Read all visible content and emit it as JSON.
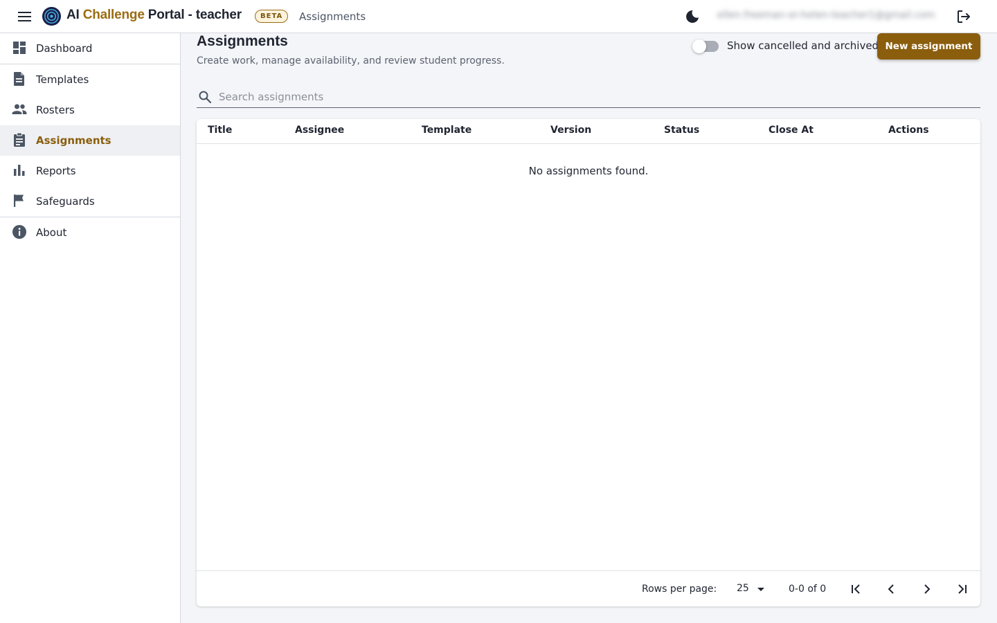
{
  "app": {
    "brand_prefix": "AI ",
    "brand_accent": "Challenge",
    "brand_suffix": " Portal - teacher",
    "beta_badge": "BETA",
    "breadcrumb": "Assignments",
    "user_email": "ellen.freeman-or-helen-teacher1@gmail.com",
    "accent_color": "#8a5e0d"
  },
  "sidebar": {
    "items": [
      {
        "label": "Dashboard",
        "icon": "dashboard-icon"
      },
      {
        "label": "Templates",
        "icon": "document-icon"
      },
      {
        "label": "Rosters",
        "icon": "people-icon"
      },
      {
        "label": "Assignments",
        "icon": "clipboard-icon",
        "active": true
      },
      {
        "label": "Reports",
        "icon": "bar-chart-icon"
      },
      {
        "label": "Safeguards",
        "icon": "flag-icon"
      },
      {
        "label": "About",
        "icon": "info-icon"
      }
    ]
  },
  "main": {
    "title": "Assignments",
    "subtitle": "Create work, manage availability, and review student progress.",
    "show_cancelled_label": "Show cancelled and archived",
    "show_cancelled_on": false,
    "new_button": "New assignment",
    "search_placeholder": "Search assignments",
    "table": {
      "columns": [
        "Title",
        "Assignee",
        "Template",
        "Version",
        "Status",
        "Close At",
        "Actions"
      ],
      "rows": [],
      "empty_message": "No assignments found."
    },
    "pagination": {
      "rows_per_page_label": "Rows per page:",
      "rows_per_page": "25",
      "range": "0-0 of 0"
    }
  }
}
